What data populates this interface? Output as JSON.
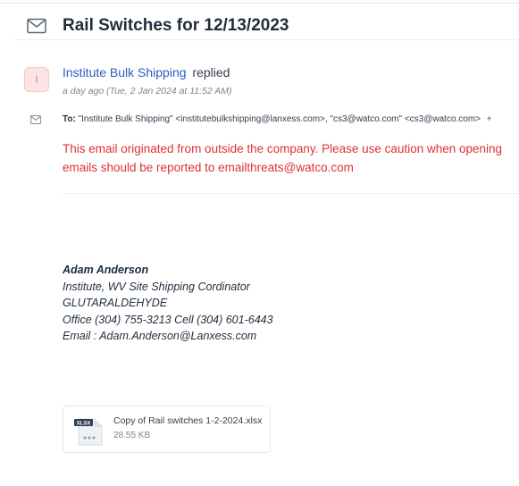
{
  "ticket": {
    "title": "Rail Switches for 12/13/2023"
  },
  "message": {
    "avatar_letter": "I",
    "sender": "Institute Bulk Shipping",
    "action": "replied",
    "timestamp": "a day ago (Tue, 2 Jan 2024 at 11:52 AM)",
    "to_label": "To:",
    "to_value": "\"Institute Bulk Shipping\" <institutebulkshipping@lanxess.com>, \"cs3@watco.com\" <cs3@watco.com>",
    "to_more": "+",
    "warning_line1": "This email originated from outside the company. Please use caution when opening",
    "warning_line2": "emails should be reported to emailthreats@watco.com"
  },
  "signature": {
    "name": "Adam Anderson",
    "title": "Institute, WV Site Shipping Cordinator",
    "product": "GLUTARALDEHYDE",
    "phones": "Office (304) 755-3213 Cell (304) 601-6443",
    "email": "Email : Adam.Anderson@Lanxess.com"
  },
  "attachment": {
    "file_name": "Copy of Rail switches 1-2-2024.xlsx",
    "file_size": "28.55 KB",
    "file_type": "XLSX"
  },
  "colors": {
    "link": "#2c5cc5",
    "warning": "#e03131",
    "avatar_bg": "#fde4e4",
    "avatar_text": "#e57373",
    "xlsx_badge": "#2f3f52"
  },
  "icons": {
    "header": "envelope-icon",
    "recipient": "envelope-icon",
    "attachment": "spreadsheet-file-icon"
  }
}
